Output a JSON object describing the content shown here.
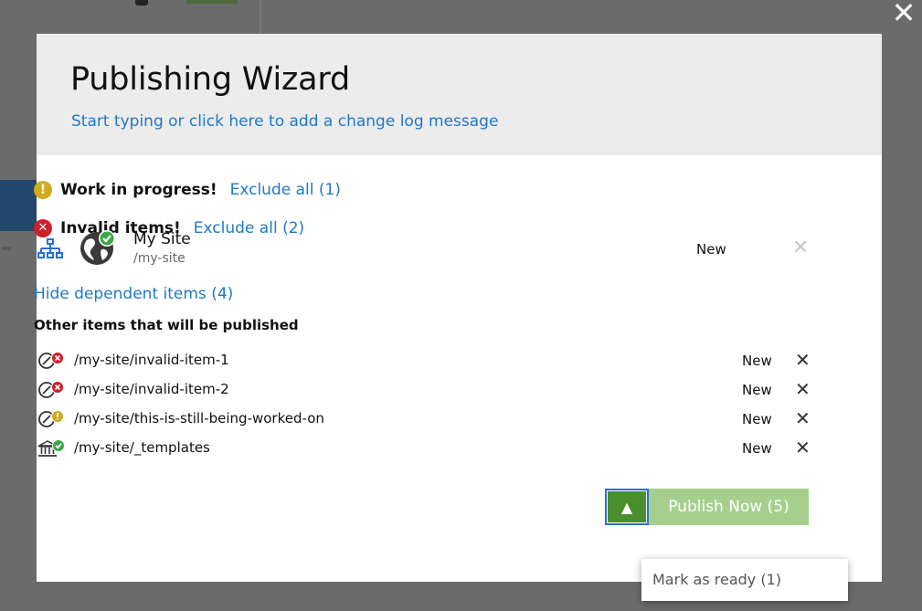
{
  "wizard": {
    "title": "Publishing Wizard",
    "changelog_prompt": "Start typing or click here to add a change log message",
    "close_symbol": "✕"
  },
  "warnings": {
    "wip": {
      "icon": "warning-icon",
      "symbol": "!",
      "label": "Work in progress!",
      "action": "Exclude all (1)"
    },
    "invalid": {
      "icon": "error-icon",
      "symbol": "✕",
      "label": "Invalid items!",
      "action": "Exclude all (2)"
    }
  },
  "site": {
    "name": "My Site",
    "path": "/my-site",
    "status": "New",
    "remove_symbol": "✕"
  },
  "dependents": {
    "toggle_label": "Hide dependent items (4)",
    "heading": "Other items that will be published",
    "items": [
      {
        "path": "/my-site/invalid-item-1",
        "status": "New",
        "icon": "invalid-item-icon",
        "remove_symbol": "✕"
      },
      {
        "path": "/my-site/invalid-item-2",
        "status": "New",
        "icon": "invalid-item-icon",
        "remove_symbol": "✕"
      },
      {
        "path": "/my-site/this-is-still-being-worked-on",
        "status": "New",
        "icon": "wip-item-icon",
        "remove_symbol": "✕"
      },
      {
        "path": "/my-site/_templates",
        "status": "New",
        "icon": "templates-icon",
        "remove_symbol": "✕"
      }
    ]
  },
  "actions": {
    "toggle_symbol": "▲",
    "publish_label": "Publish Now (5)",
    "menu_items": [
      "Mark as ready (1)"
    ]
  },
  "colors": {
    "link": "#1f78c7",
    "warning": "#d1aa1f",
    "error": "#cf1f2b",
    "success": "#3ba84a",
    "publish": "#a6cf8e",
    "toggle": "#4a8f2e"
  }
}
